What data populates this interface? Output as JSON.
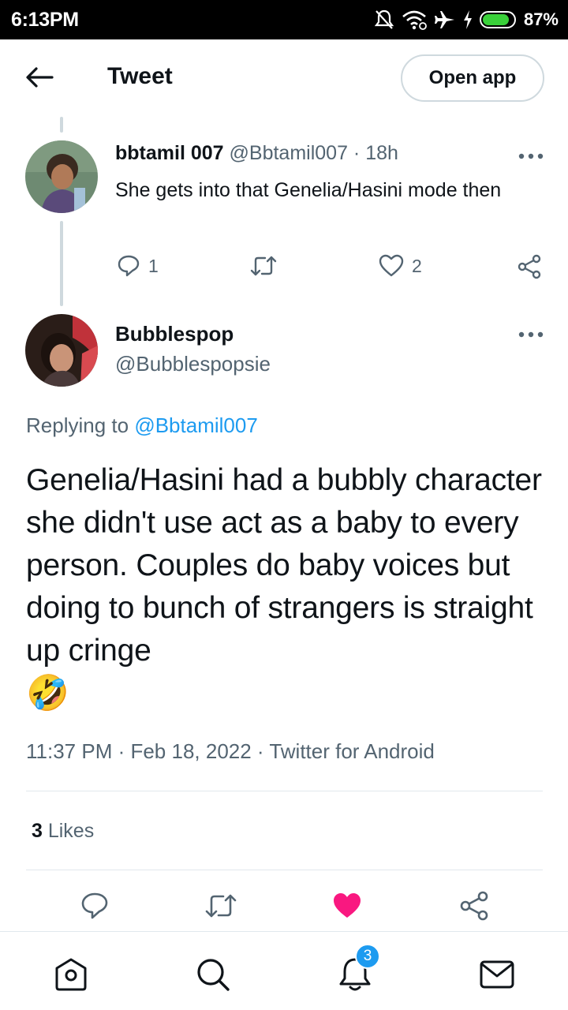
{
  "status_bar": {
    "time": "6:13PM",
    "battery_percent": "87%",
    "icons": [
      "mute-icon",
      "wifi-icon",
      "airplane-icon",
      "charging-icon",
      "battery-icon"
    ],
    "battery_level": 0.87
  },
  "header": {
    "title": "Tweet",
    "open_app_label": "Open app"
  },
  "parent_tweet": {
    "name": "bbtamil 007",
    "handle": "@Bbtamil007",
    "separator": " · ",
    "age": "18h",
    "text": "She gets into that Genelia/Hasini mode then",
    "reply_count": "1",
    "like_count": "2"
  },
  "main_tweet": {
    "name": "Bubblespop",
    "handle": "@Bubblespopsie",
    "replying_label": "Replying to ",
    "replying_to": "@Bbtamil007",
    "text": "Genelia/Hasini had a bubbly character she didn't use act as a baby to every person. Couples do baby voices but doing to bunch of strangers is straight up cringe",
    "emoji": "🤣",
    "timestamp": "11:37 PM · Feb 18, 2022 · Twitter for Android",
    "likes_count": "3",
    "likes_label": " Likes"
  },
  "bottom_nav": {
    "notification_badge": "3",
    "items": [
      "home-icon",
      "search-icon",
      "notifications-icon",
      "messages-icon"
    ]
  },
  "colors": {
    "accent": "#1d9bf0",
    "like_active": "#f91880",
    "text_secondary": "#536471",
    "border": "#cfd9de"
  }
}
